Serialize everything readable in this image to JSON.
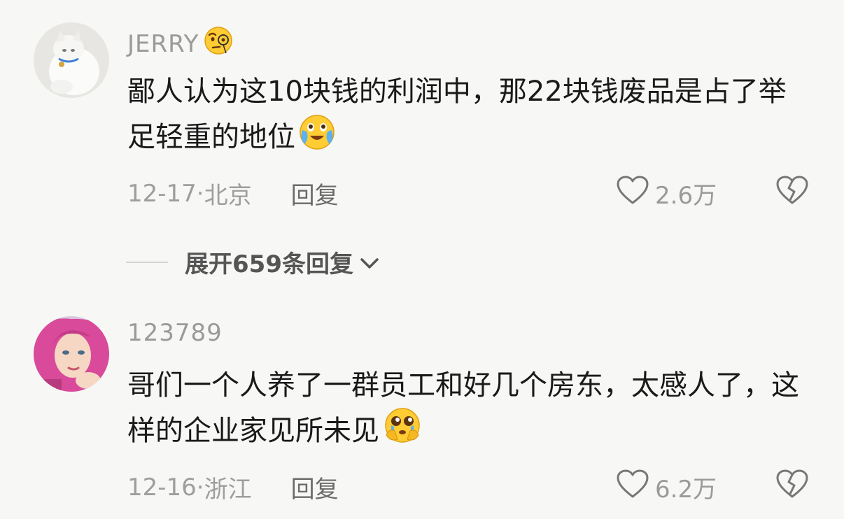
{
  "comments": [
    {
      "username": "JERRY",
      "username_emoji": "monocle-face-emoji",
      "text": "鄙人认为这10块钱的利润中，那22块钱废品是占了举足轻重的地位",
      "text_emoji": "joy-tears-emoji",
      "date": "12-17",
      "location": "北京",
      "reply_label": "回复",
      "likes": "2.6万",
      "avatar": "white-cat-avatar"
    },
    {
      "username": "123789",
      "text": "哥们一个人养了一群员工和好几个房东，太感人了，这样的企业家见所未见",
      "text_emoji": "pleading-tears-emoji",
      "date": "12-16",
      "location": "浙江",
      "reply_label": "回复",
      "likes": "6.2万",
      "avatar": "pink-hair-girl-avatar"
    }
  ],
  "expand_replies": {
    "label": "展开659条回复"
  },
  "icons": {
    "like": "heart-outline-icon",
    "dislike": "broken-heart-icon",
    "expand": "chevron-down-icon"
  },
  "colors": {
    "background": "#f7f7f5",
    "text": "#1a1a1a",
    "muted": "#9a9a9a"
  }
}
